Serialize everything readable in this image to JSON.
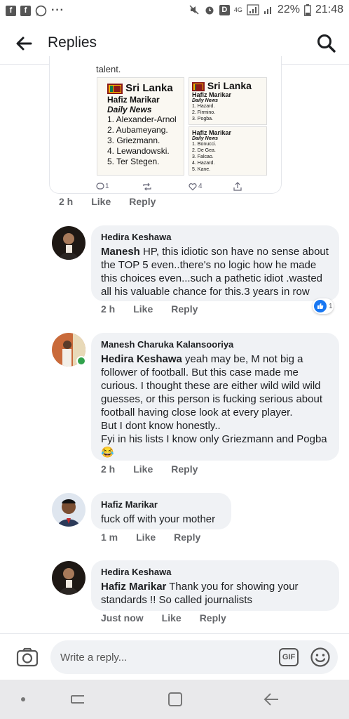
{
  "status_bar": {
    "battery": "22%",
    "time": "21:48",
    "network": "4G",
    "dots": "···"
  },
  "header": {
    "title": "Replies"
  },
  "shared_post": {
    "text": "talent.",
    "image_left": {
      "country": "Sri Lanka",
      "author": "Hafiz Marikar",
      "outlet": "Daily News",
      "items": [
        "1. Alexander-Arnol",
        "2. Aubameyang.",
        "3. Griezmann.",
        "4. Lewandowski.",
        "5. Ter Stegen."
      ]
    },
    "image_right_top": {
      "country": "Sri Lanka",
      "author": "Hafiz Marikar",
      "outlet": "Daily News",
      "items": [
        "1. Hazard.",
        "2. Firmino.",
        "3. Pogba."
      ]
    },
    "image_right_bottom": {
      "author": "Hafiz Marikar",
      "outlet": "Daily News",
      "items": [
        "1. Bonucci.",
        "2. De Gea.",
        "3. Falcao.",
        "4. Hazard.",
        "5. Kane."
      ]
    },
    "tweet_actions": {
      "replies": "1",
      "likes": "4"
    },
    "time": "2 h",
    "like": "Like",
    "reply": "Reply"
  },
  "comments": [
    {
      "author": "Hedira Keshawa",
      "mention": "Manesh",
      "text": " HP, this idiotic son have no sense about the TOP 5 even..there's no logic how he made this choices even...such a pathetic idiot .wasted all his valuable chance for this.3 years in row",
      "time": "2 h",
      "like": "Like",
      "reply": "Reply",
      "reactions": "1"
    },
    {
      "author": "Manesh Charuka Kalansooriya",
      "mention": "Hedira Keshawa",
      "text": " yeah may be, M not big a follower of football. But this case made me curious. I thought these are either wild wild wild guesses, or this person is fucking serious about football having close look at every player.",
      "text2": "But I dont know honestly..",
      "text3": "Fyi in his lists I know only Griezmann and Pogba",
      "emoji": "😂",
      "time": "2 h",
      "like": "Like",
      "reply": "Reply"
    },
    {
      "author": "Hafiz Marikar",
      "text": "fuck off with your mother",
      "time": "1 m",
      "like": "Like",
      "reply": "Reply"
    },
    {
      "author": "Hedira Keshawa",
      "mention": "Hafiz Marikar",
      "text": " Thank you for showing your standards !! So called journalists",
      "time": "Just now",
      "like": "Like",
      "reply": "Reply"
    }
  ],
  "reply_bar": {
    "placeholder": "Write a reply...",
    "gif": "GIF"
  },
  "colors": {
    "accent": "#1877f2",
    "bubble": "#f0f2f5",
    "meta": "#65676b",
    "online": "#31a24c"
  }
}
